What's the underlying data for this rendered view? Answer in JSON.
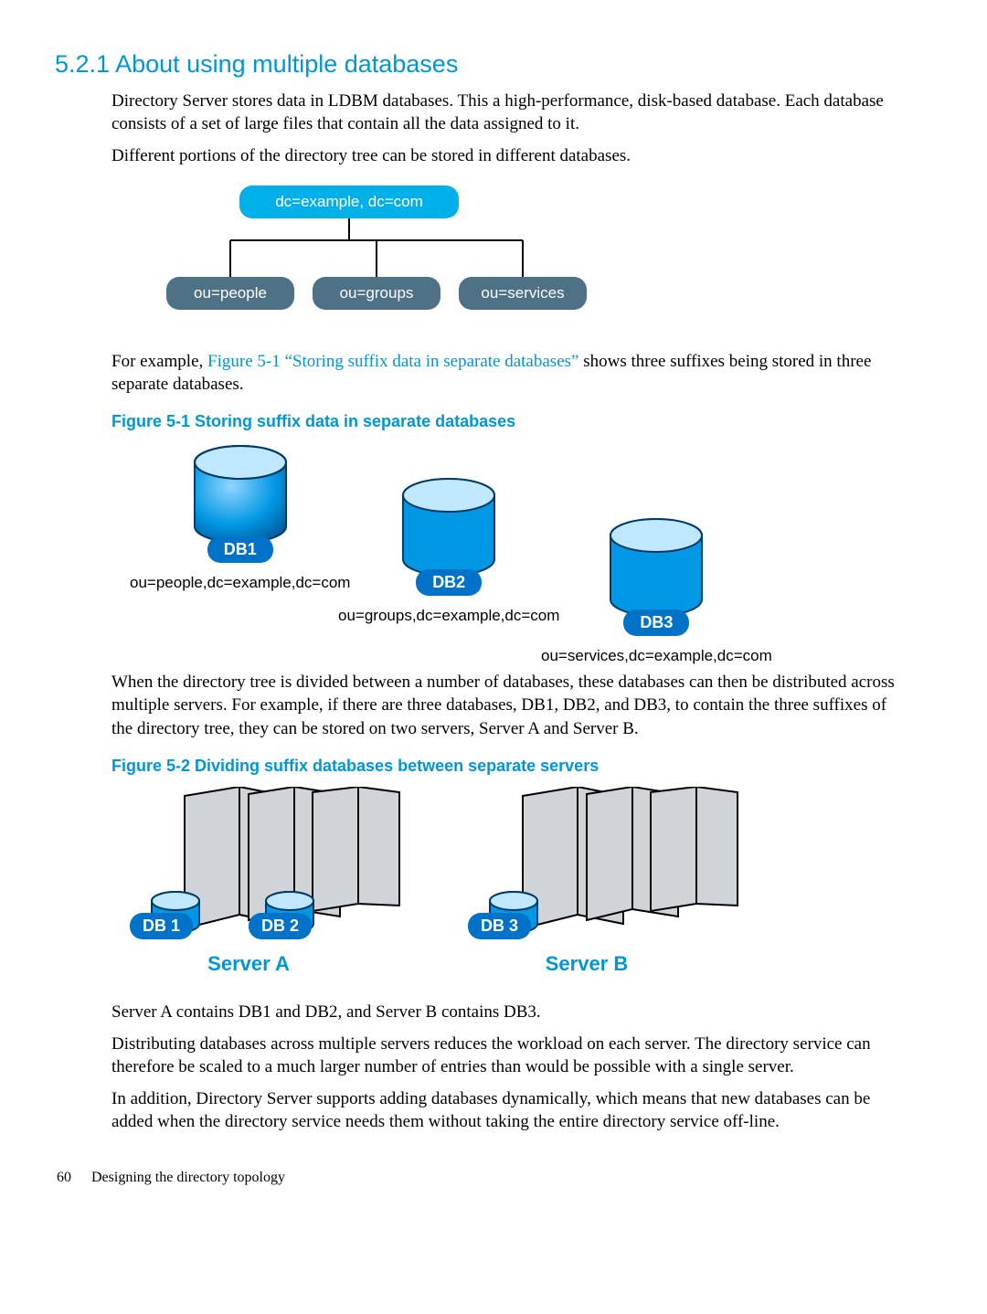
{
  "section": {
    "number": "5.2.1",
    "title": "About using multiple databases"
  },
  "paragraphs": {
    "p1": "Directory Server stores data in LDBM databases. This a high-performance, disk-based database. Each database consists of a set of large files that contain all the data assigned to it.",
    "p2": "Different portions of the directory tree can be stored in different databases.",
    "p3a": "For example, ",
    "p3link": "Figure 5-1 “Storing suffix data in separate databases”",
    "p3b": " shows three suffixes being stored in three separate databases.",
    "p4": "When the directory tree is divided between a number of databases, these databases can then be distributed across multiple servers. For example, if there are three databases, DB1, DB2, and DB3, to contain the three suffixes of the directory tree, they can be stored on two servers, Server A and Server B.",
    "p5": "Server A contains DB1 and DB2, and Server B contains DB3.",
    "p6": "Distributing databases across multiple servers reduces the workload on each server. The directory service can therefore be scaled to a much larger number of entries than would be possible with a single server.",
    "p7": "In addition, Directory Server supports adding databases dynamically, which means that new databases can be added when the directory service needs them without taking the entire directory service off-line."
  },
  "tree": {
    "root": "dc=example, dc=com",
    "children": [
      "ou=people",
      "ou=groups",
      "ou=services"
    ]
  },
  "figure51": {
    "caption": "Figure 5-1 Storing suffix data in separate databases",
    "items": [
      {
        "badge": "DB1",
        "dn": "ou=people,dc=example,dc=com"
      },
      {
        "badge": "DB2",
        "dn": "ou=groups,dc=example,dc=com"
      },
      {
        "badge": "DB3",
        "dn": "ou=services,dc=example,dc=com"
      }
    ]
  },
  "figure52": {
    "caption": "Figure 5-2 Dividing suffix databases between separate servers",
    "servers": [
      {
        "label": "Server A",
        "dbs": [
          "DB 1",
          "DB 2"
        ]
      },
      {
        "label": "Server B",
        "dbs": [
          "DB 3"
        ]
      }
    ]
  },
  "footer": {
    "page": "60",
    "chapter": "Designing the directory topology"
  }
}
